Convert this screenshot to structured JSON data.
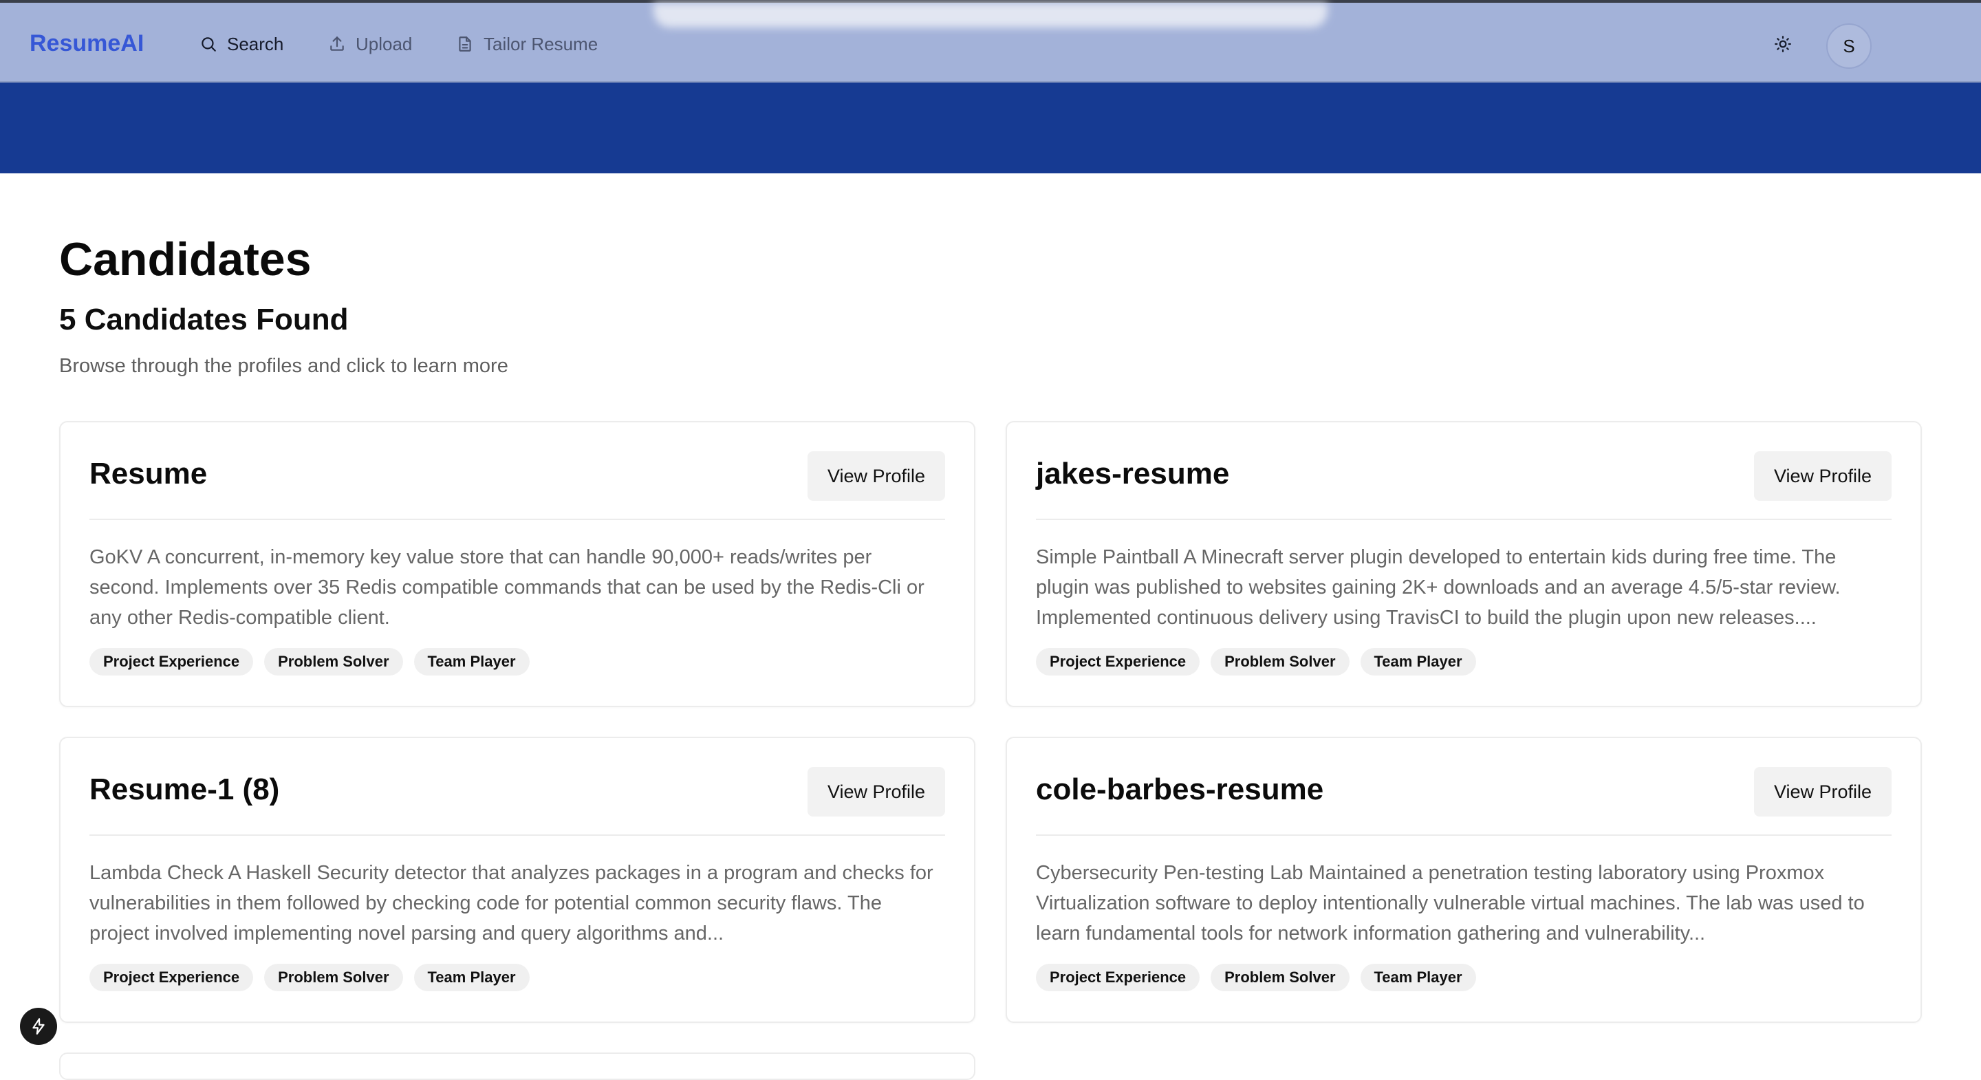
{
  "header": {
    "logo": "ResumeAI",
    "nav": [
      {
        "label": "Search",
        "icon": "search-icon",
        "active": true
      },
      {
        "label": "Upload",
        "icon": "upload-icon",
        "active": false
      },
      {
        "label": "Tailor Resume",
        "icon": "document-icon",
        "active": false
      }
    ],
    "theme_icon": "sun-icon",
    "avatar_initial": "S"
  },
  "main": {
    "title": "Candidates",
    "count_label": "5 Candidates Found",
    "subtitle": "Browse through the profiles and click to learn more",
    "view_label": "View Profile",
    "candidates": [
      {
        "name": "Resume",
        "description": "GoKV A concurrent, in-memory key value store that can handle 90,000+ reads/writes per second. Implements over 35 Redis compatible commands that can be used by the Redis-Cli or any other Redis-compatible client.",
        "tags": [
          "Project Experience",
          "Problem Solver",
          "Team Player"
        ]
      },
      {
        "name": "jakes-resume",
        "description": "Simple Paintball A Minecraft server plugin developed to entertain kids during free time. The plugin was published to websites gaining 2K+ downloads and an average 4.5/5-star review. Implemented continuous delivery using TravisCI to build the plugin upon new releases....",
        "tags": [
          "Project Experience",
          "Problem Solver",
          "Team Player"
        ]
      },
      {
        "name": "Resume-1 (8)",
        "description": "Lambda Check A Haskell Security detector that analyzes packages in a program and checks for vulnerabilities in them followed by checking code for potential common security flaws. The project involved implementing novel parsing and query algorithms and...",
        "tags": [
          "Project Experience",
          "Problem Solver",
          "Team Player"
        ]
      },
      {
        "name": "cole-barbes-resume",
        "description": "Cybersecurity Pen-testing Lab Maintained a penetration testing laboratory using Proxmox Virtualization software to deploy intentionally vulnerable virtual machines. The lab was used to learn fundamental tools for network information gathering and vulnerability...",
        "tags": [
          "Project Experience",
          "Problem Solver",
          "Team Player"
        ]
      }
    ]
  },
  "colors": {
    "brand": "#3657d6",
    "header_bg": "#a3b2d9",
    "banner_bg": "#163a92"
  },
  "floating_icon": "bolt-icon"
}
